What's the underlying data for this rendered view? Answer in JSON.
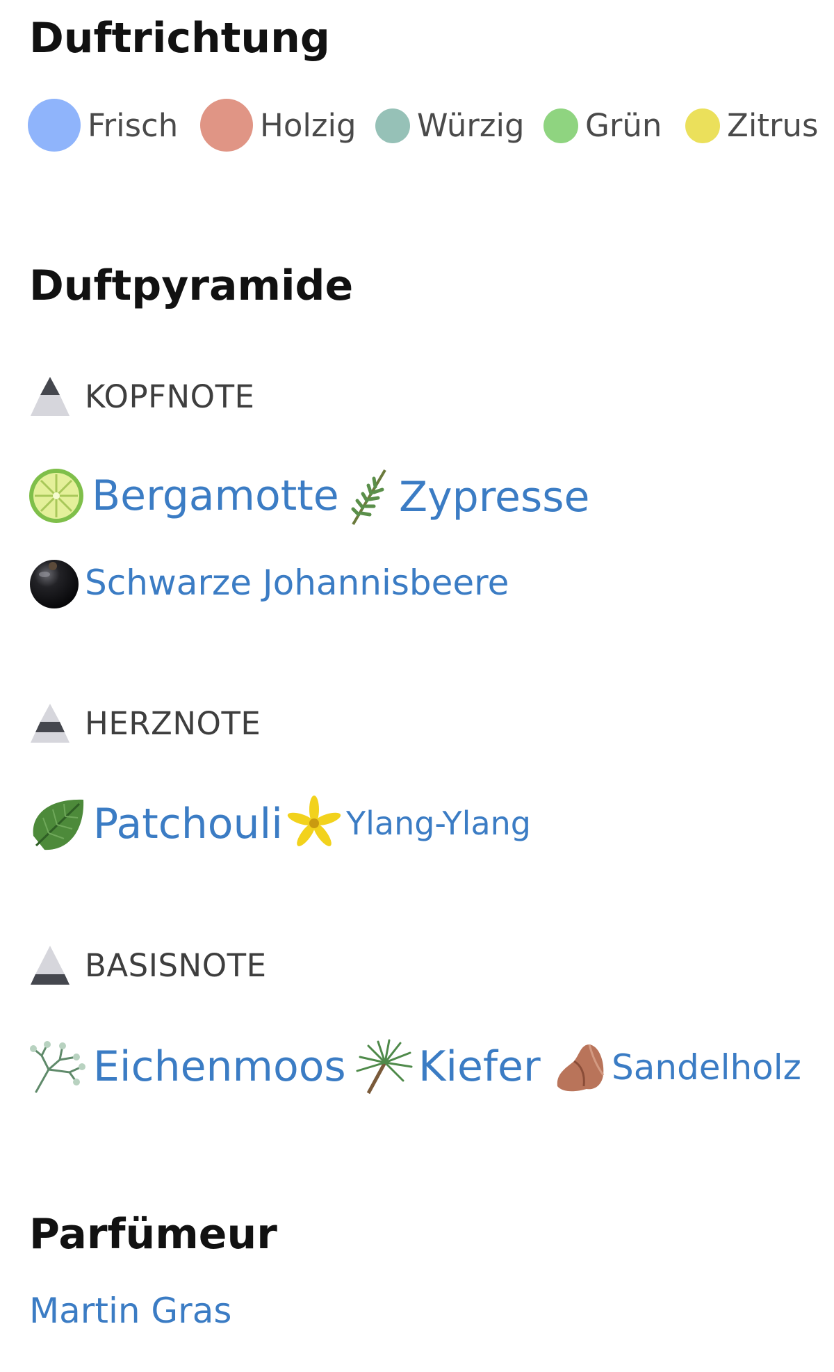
{
  "colors": {
    "heading": "#111111",
    "link": "#3b7cc4",
    "legend_text": "#4a4a4a"
  },
  "duftrichtung": {
    "title": "Duftrichtung",
    "items": [
      {
        "label": "Frisch",
        "color": "#8fb4fb"
      },
      {
        "label": "Holzig",
        "color": "#e09585"
      },
      {
        "label": "Würzig",
        "color": "#96c1b7"
      },
      {
        "label": "Grün",
        "color": "#8fd480"
      },
      {
        "label": "Zitrus",
        "color": "#ebe05b"
      }
    ]
  },
  "duftpyramide": {
    "title": "Duftpyramide",
    "tiers": [
      {
        "label": "KOPFNOTE",
        "icon": "pyramid-top-icon",
        "notes": [
          {
            "name": "Bergamotte",
            "icon": "bergamot-icon"
          },
          {
            "name": "Zypresse",
            "icon": "cypress-icon"
          },
          {
            "name": "Schwarze Johannisbeere",
            "icon": "blackcurrant-icon"
          }
        ]
      },
      {
        "label": "HERZNOTE",
        "icon": "pyramid-middle-icon",
        "notes": [
          {
            "name": "Patchouli",
            "icon": "patchouli-leaf-icon"
          },
          {
            "name": "Ylang-Ylang",
            "icon": "ylang-ylang-flower-icon"
          }
        ]
      },
      {
        "label": "BASISNOTE",
        "icon": "pyramid-base-icon",
        "notes": [
          {
            "name": "Eichenmoos",
            "icon": "oakmoss-icon"
          },
          {
            "name": "Kiefer",
            "icon": "pine-icon"
          },
          {
            "name": "Sandelholz",
            "icon": "sandalwood-icon"
          }
        ]
      }
    ]
  },
  "parfumeur": {
    "title": "Parfümeur",
    "name": "Martin Gras"
  }
}
